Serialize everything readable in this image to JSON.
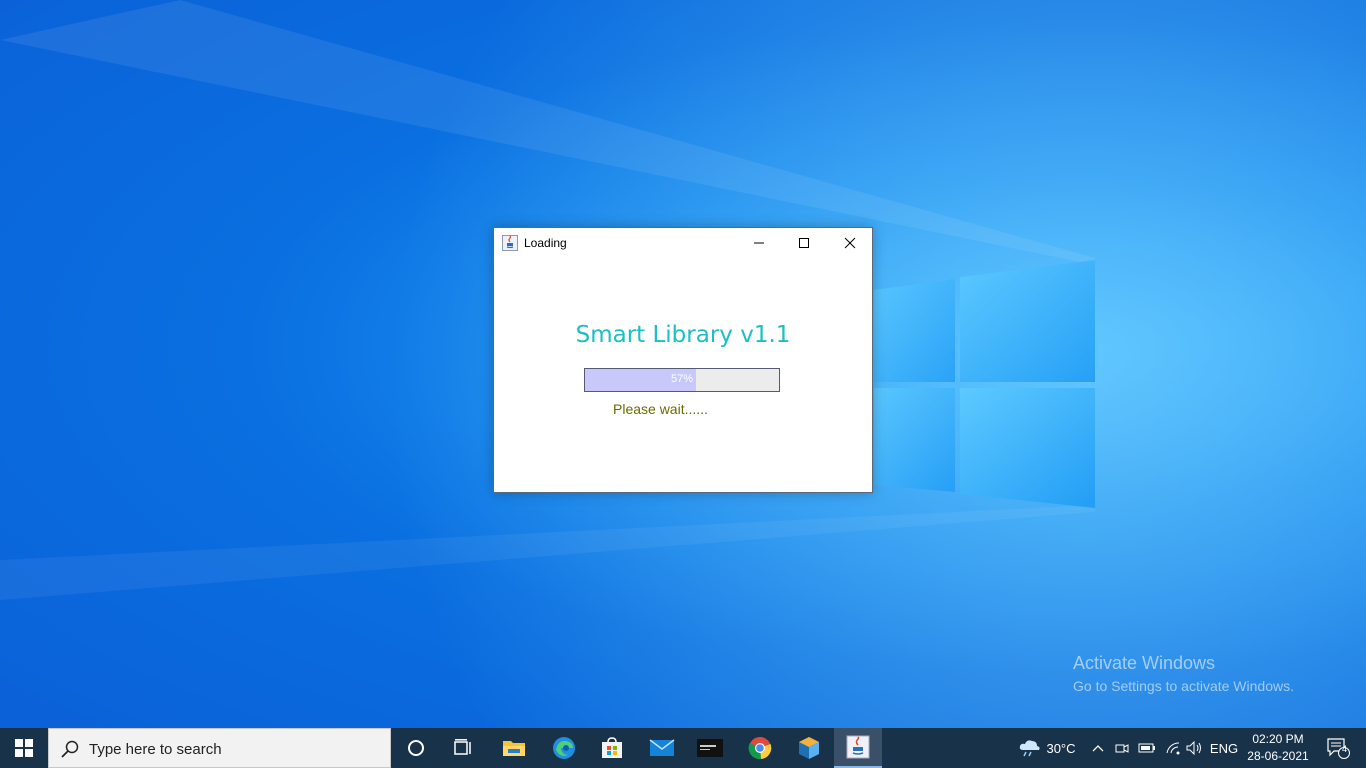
{
  "window": {
    "title": "Loading",
    "app_title": "Smart Library v1.1",
    "progress": {
      "value_percent": 57,
      "label": "57%"
    },
    "status_text": "Please wait......"
  },
  "desktop": {
    "activate_title": "Activate Windows",
    "activate_subtitle": "Go to Settings to activate Windows."
  },
  "taskbar": {
    "search_placeholder": "Type here to search",
    "pinned": [
      "cortana-icon",
      "task-view-icon",
      "file-explorer-icon",
      "edge-icon",
      "store-icon",
      "mail-icon",
      "mysql-icon",
      "chrome-icon",
      "netbeans-icon",
      "java-icon"
    ],
    "weather": "30°C",
    "language": "ENG",
    "time": "02:20 PM",
    "date": "28-06-2021",
    "notifications_count": "4"
  },
  "colors": {
    "app_title": "#1cc0c4",
    "progress_fill": "#c8c8fa",
    "status_text": "#6b6b00",
    "taskbar": "#18324a"
  }
}
